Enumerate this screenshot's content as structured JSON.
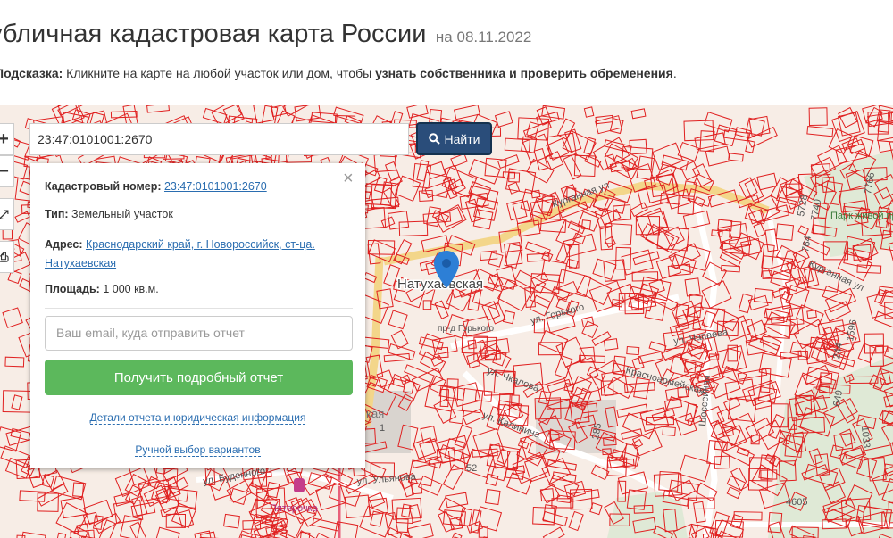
{
  "header": {
    "title": "убличная кадастровая карта России",
    "date": "на 08.11.2022"
  },
  "hint": {
    "label": "Подсказка:",
    "text": " Кликните на карте на любой участок или дом, чтобы ",
    "bold": "узнать собственника и проверить обременения",
    "end": "."
  },
  "map_controls": {
    "zoom_in": "+",
    "zoom_out": "−",
    "fullscreen": "⤢",
    "print": "⎙"
  },
  "search": {
    "value": "23:47:0101001:2670",
    "button_label": "Найти"
  },
  "info_panel": {
    "close": "×",
    "cadastral_label": "Кадастровый номер:",
    "cadastral_value": "23:47:0101001:2670",
    "type_label": "Тип:",
    "type_value": "Земельный участок",
    "address_label": "Адрес:",
    "address_line1": "Краснодарский край, г. Новороссийск, ст-ца.",
    "address_line2": "Натухаевская",
    "area_label": "Площадь:",
    "area_value": "1 000 кв.м.",
    "email_placeholder": "Ваш email, куда отправить отчет",
    "report_button": "Получить подробный отчет",
    "details_link": "Детали отчета и юридическая информация",
    "manual_link": "Ручной выбор вариантов"
  },
  "map_labels": {
    "village": "Натухаевская",
    "street_kurgannaya": "Курганная ул",
    "street_kurgannaya2": "Курганная ул",
    "street_gorkogo": "ул. Горького",
    "street_gorkogo2": "пр-д Горького",
    "street_chkalova": "ул. Чкалова",
    "street_novaya": "ул. Чапаева",
    "street_shosseinaya": "Шоссейная",
    "street_budennogo": "ул. Буденного",
    "street_ulyanova": "ул. Ульянова",
    "street_kalinina": "ул. Калинина",
    "street_krasnoarm": "Красноармейская",
    "park": "Парк живой природы До-...",
    "shop": "Пятерочка",
    "num_4605": "4605",
    "num_649": "649",
    "num_1033": "1033",
    "num_244": "244",
    "num_1596": "1596",
    "num_764": "764",
    "num_7766": "7766",
    "num_5728": "5728",
    "num_7740": "7740",
    "num_285": "285",
    "num_52": "52",
    "num_1": "1",
    "kaya": "кая"
  },
  "colors": {
    "parcel": "#e02020",
    "road": "#f3d68a",
    "map_bg": "#f7ede6",
    "green_area": "#dfe9d6",
    "accent_button": "#2a4d7a",
    "report_green": "#5cb85c",
    "pin": "#2d7fd6"
  }
}
